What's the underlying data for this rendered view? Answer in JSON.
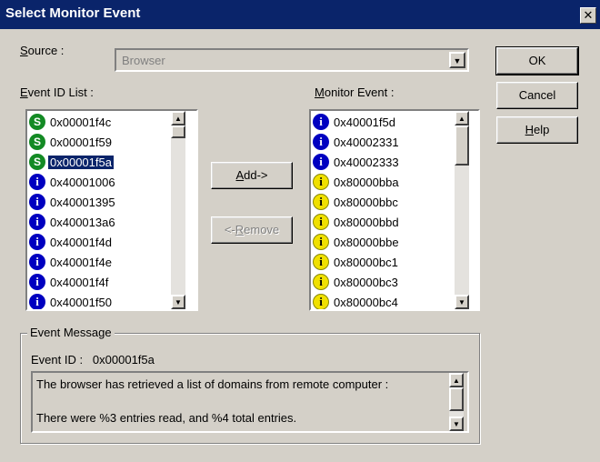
{
  "window": {
    "title": "Select Monitor Event",
    "close_glyph": "✕"
  },
  "source": {
    "label": "Source :",
    "mnemonic": "S",
    "label_rest": "ource :",
    "value": "Browser"
  },
  "event_id_list": {
    "label_mnemonic": "E",
    "label_rest": "vent ID List :",
    "items": [
      {
        "icon": "S",
        "type": "success",
        "text": "0x00001f4c"
      },
      {
        "icon": "S",
        "type": "success",
        "text": "0x00001f59"
      },
      {
        "icon": "S",
        "type": "success",
        "text": "0x00001f5a",
        "selected": true
      },
      {
        "icon": "i",
        "type": "info",
        "text": "0x40001006"
      },
      {
        "icon": "i",
        "type": "info",
        "text": "0x40001395"
      },
      {
        "icon": "i",
        "type": "info",
        "text": "0x400013a6"
      },
      {
        "icon": "i",
        "type": "info",
        "text": "0x40001f4d"
      },
      {
        "icon": "i",
        "type": "info",
        "text": "0x40001f4e"
      },
      {
        "icon": "i",
        "type": "info",
        "text": "0x40001f4f"
      },
      {
        "icon": "i",
        "type": "info",
        "text": "0x40001f50"
      }
    ]
  },
  "monitor_event": {
    "label_mnemonic": "M",
    "label_rest": "onitor Event :",
    "items": [
      {
        "icon": "i",
        "type": "info",
        "text": "0x40001f5d"
      },
      {
        "icon": "i",
        "type": "info",
        "text": "0x40002331"
      },
      {
        "icon": "i",
        "type": "info",
        "text": "0x40002333"
      },
      {
        "icon": "i",
        "type": "warning",
        "text": "0x80000bba"
      },
      {
        "icon": "i",
        "type": "warning",
        "text": "0x80000bbc"
      },
      {
        "icon": "i",
        "type": "warning",
        "text": "0x80000bbd"
      },
      {
        "icon": "i",
        "type": "warning",
        "text": "0x80000bbe"
      },
      {
        "icon": "i",
        "type": "warning",
        "text": "0x80000bc1"
      },
      {
        "icon": "i",
        "type": "warning",
        "text": "0x80000bc3"
      },
      {
        "icon": "i",
        "type": "warning",
        "text": "0x80000bc4"
      }
    ]
  },
  "buttons": {
    "add_mnemonic": "A",
    "add_rest": "dd->",
    "remove_pre": "<-",
    "remove_mnemonic": "R",
    "remove_rest": "emove",
    "ok": "OK",
    "cancel": "Cancel",
    "help_mnemonic": "H",
    "help_rest": "elp"
  },
  "event_message": {
    "group_title": "Event Message",
    "event_id_label": "Event ID :",
    "event_id_value": "0x00001f5a",
    "lines": [
      "The browser has retrieved a list of domains from remote computer :",
      "There were %3 entries read, and %4 total entries."
    ]
  },
  "glyphs": {
    "up": "▲",
    "down": "▼"
  },
  "colors": {
    "title_bar": "#0a246a",
    "face": "#d4d0c8",
    "selection": "#0a246a",
    "success_icon": "#138a24",
    "info_icon": "#0000c0",
    "warning_icon": "#f0e000"
  }
}
